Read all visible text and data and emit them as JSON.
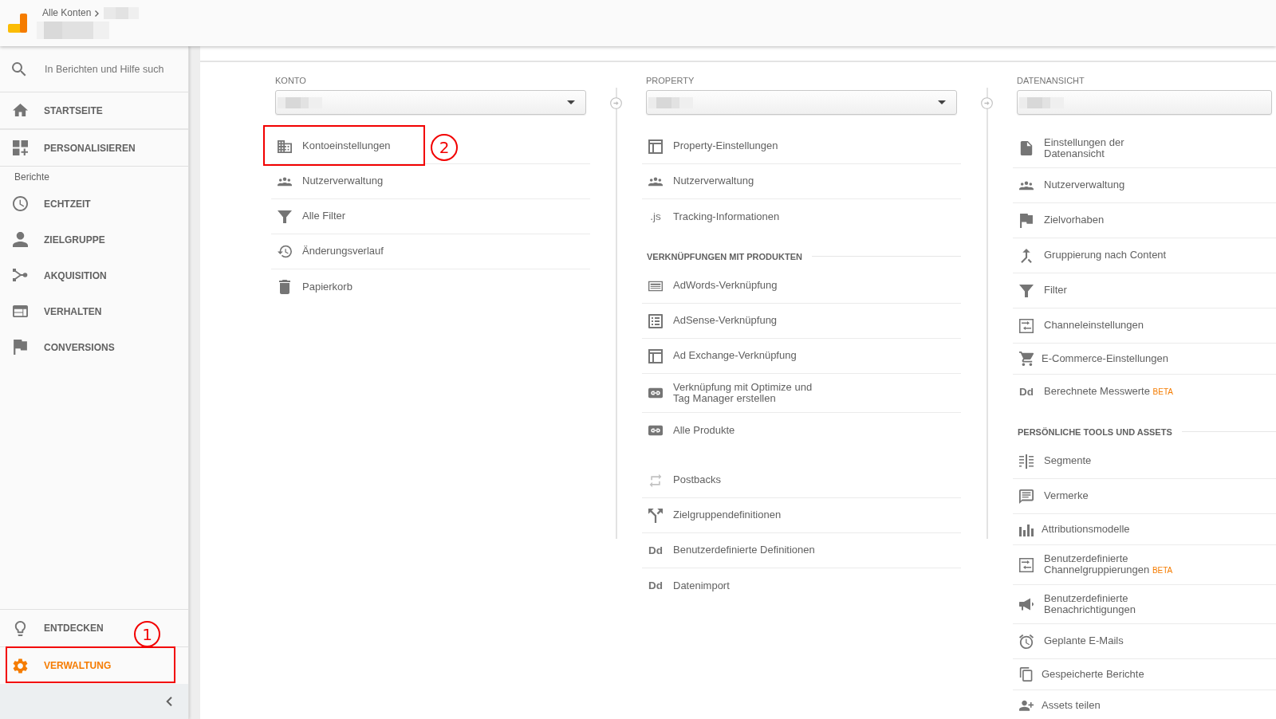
{
  "header": {
    "breadcrumb": "Alle Konten"
  },
  "sidebar": {
    "search": {
      "placeholder": "In Berichten und Hilfe such"
    },
    "top_items": [
      {
        "label": "STARTSEITE",
        "selected": false
      },
      {
        "label": "PERSONALISIEREN",
        "selected": false
      }
    ],
    "section_label": "Berichte",
    "report_items": [
      {
        "label": "ECHTZEIT",
        "selected": false
      },
      {
        "label": "ZIELGRUPPE",
        "selected": false
      },
      {
        "label": "AKQUISITION",
        "selected": false
      },
      {
        "label": "VERHALTEN",
        "selected": false
      },
      {
        "label": "CONVERSIONS",
        "selected": false
      }
    ],
    "bottom_items": [
      {
        "label": "ENTDECKEN",
        "selected": false
      },
      {
        "label": "VERWALTUNG",
        "selected": true,
        "step": "1"
      }
    ]
  },
  "columns": [
    {
      "label": "KONTO",
      "dropdown_arrow": true,
      "sections": [
        {
          "items": [
            {
              "label": "Kontoeinstellungen",
              "step": "2"
            },
            {
              "label": "Nutzerverwaltung"
            },
            {
              "label": "Alle Filter"
            },
            {
              "label": "Änderungsverlauf"
            },
            {
              "label": "Papierkorb"
            }
          ]
        }
      ]
    },
    {
      "label": "PROPERTY",
      "dropdown_arrow": true,
      "sections": [
        {
          "items": [
            {
              "label": "Property-Einstellungen"
            },
            {
              "label": "Nutzerverwaltung"
            },
            {
              "label": "Tracking-Informationen",
              "icon_text": ".js"
            }
          ]
        },
        {
          "heading": "VERKNÜPFUNGEN MIT PRODUKTEN",
          "items": [
            {
              "label": "AdWords-Verknüpfung"
            },
            {
              "label": "AdSense-Verknüpfung"
            },
            {
              "label": "Ad Exchange-Verknüpfung"
            },
            {
              "label": "Verknüpfung mit Optimize und\nTag Manager erstellen"
            },
            {
              "label": "Alle Produkte"
            }
          ]
        },
        {
          "items": [
            {
              "label": "Postbacks"
            },
            {
              "label": "Zielgruppendefinitionen"
            },
            {
              "label": "Benutzerdefinierte Definitionen",
              "icon_text": "Dd"
            },
            {
              "label": "Datenimport",
              "icon_text": "Dd"
            }
          ]
        }
      ]
    },
    {
      "label": "DATENANSICHT",
      "sections": [
        {
          "items": [
            {
              "label": "Einstellungen der\nDatenansicht"
            },
            {
              "label": "Nutzerverwaltung"
            },
            {
              "label": "Zielvorhaben"
            },
            {
              "label": "Gruppierung nach Content"
            },
            {
              "label": "Filter"
            },
            {
              "label": "Channeleinstellungen"
            },
            {
              "label": "E-Commerce-Einstellungen"
            },
            {
              "label": "Berechnete Messwerte",
              "icon_text": "Dd",
              "badge": "BETA"
            }
          ]
        },
        {
          "heading": "PERSÖNLICHE TOOLS UND ASSETS",
          "items": [
            {
              "label": "Segmente"
            },
            {
              "label": "Vermerke"
            },
            {
              "label": "Attributionsmodelle"
            },
            {
              "label": "Benutzerdefinierte\nChannelgruppierungen",
              "badge": "BETA"
            },
            {
              "label": "Benutzerdefinierte\nBenachrichtigungen"
            },
            {
              "label": "Geplante E-Mails"
            },
            {
              "label": "Gespeicherte Berichte"
            },
            {
              "label": "Assets teilen"
            }
          ]
        }
      ]
    }
  ]
}
